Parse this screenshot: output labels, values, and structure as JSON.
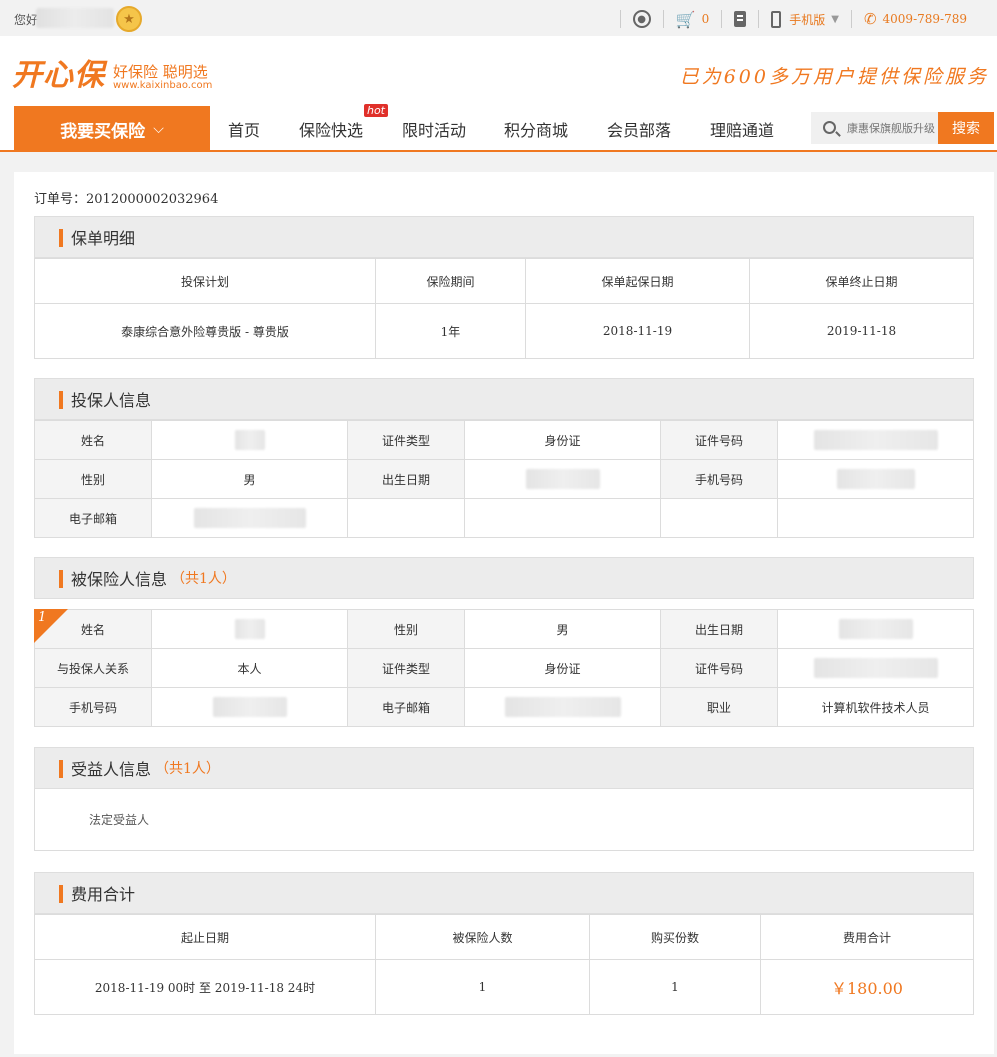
{
  "topbar": {
    "greeting": "您好",
    "cart_count": "0",
    "mobile_label": "手机版",
    "phone": "4009-789-789"
  },
  "header": {
    "logo_text": "开心保",
    "logo_slogan": "好保险 聪明选",
    "logo_url": "www.kaixinbao.com",
    "tagline": "已为600多万用户提供保险服务"
  },
  "nav": {
    "buy_label": "我要买保险",
    "items": [
      "首页",
      "保险快选",
      "限时活动",
      "积分商城",
      "会员部落",
      "理赔通道"
    ],
    "hot_badge": "hot",
    "search_placeholder": "康惠保旗舰版升级",
    "search_button": "搜索"
  },
  "order": {
    "label": "订单号：2012000002032964"
  },
  "policy": {
    "title": "保单明细",
    "headers": [
      "投保计划",
      "保险期间",
      "保单起保日期",
      "保单终止日期"
    ],
    "row": [
      "泰康综合意外险尊贵版 - 尊贵版",
      "1年",
      "2018-11-19",
      "2019-11-18"
    ]
  },
  "applicant": {
    "title": "投保人信息",
    "labels": {
      "name": "姓名",
      "id_type": "证件类型",
      "id_no": "证件号码",
      "gender": "性别",
      "birth": "出生日期",
      "mobile": "手机号码",
      "email": "电子邮箱"
    },
    "values": {
      "id_type": "身份证",
      "gender": "男"
    }
  },
  "insured": {
    "title": "被保险人信息",
    "count": "（共1人）",
    "index": "1",
    "labels": {
      "name": "姓名",
      "gender": "性别",
      "birth": "出生日期",
      "relation": "与投保人关系",
      "id_type": "证件类型",
      "id_no": "证件号码",
      "mobile": "手机号码",
      "email": "电子邮箱",
      "job": "职业"
    },
    "values": {
      "gender": "男",
      "relation": "本人",
      "id_type": "身份证",
      "job": "计算机软件技术人员"
    }
  },
  "beneficiary": {
    "title": "受益人信息",
    "count": "（共1人）",
    "text": "法定受益人"
  },
  "fees": {
    "title": "费用合计",
    "headers": [
      "起止日期",
      "被保险人数",
      "购买份数",
      "费用合计"
    ],
    "row": [
      "2018-11-19 00时 至 2019-11-18 24时",
      "1",
      "1",
      "￥180.00"
    ]
  },
  "colors": {
    "accent": "#f07820",
    "panel_bg": "#ececec"
  }
}
